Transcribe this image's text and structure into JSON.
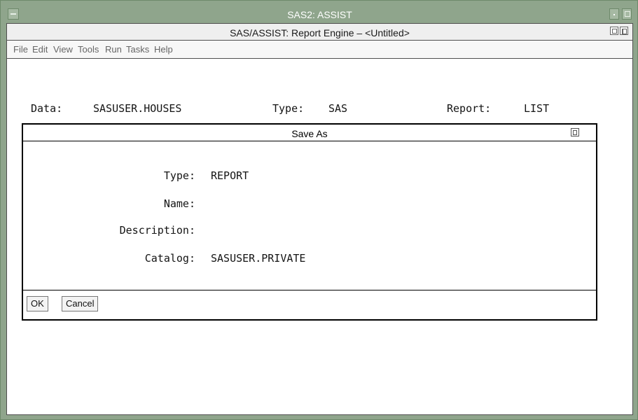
{
  "window": {
    "title": "SAS2: ASSIST"
  },
  "app": {
    "title": "SAS/ASSIST: Report Engine – <Untitled>",
    "menu": [
      "File",
      "Edit",
      "View",
      "Tools",
      "Run",
      "Tasks",
      "Help"
    ]
  },
  "header": {
    "data_label": "Data:",
    "data_value": "SASUSER.HOUSES",
    "type_label": "Type:",
    "type_value": "SAS",
    "report_label": "Report:",
    "report_value": "LIST"
  },
  "dialog": {
    "title": "Save As",
    "fields": [
      {
        "label": "Type:",
        "value": "REPORT"
      },
      {
        "label": "Name:",
        "value": ""
      },
      {
        "label": "Description:",
        "value": ""
      },
      {
        "label": "Catalog:",
        "value": "SASUSER.PRIVATE"
      }
    ],
    "ok_label": "OK",
    "cancel_label": "Cancel"
  }
}
